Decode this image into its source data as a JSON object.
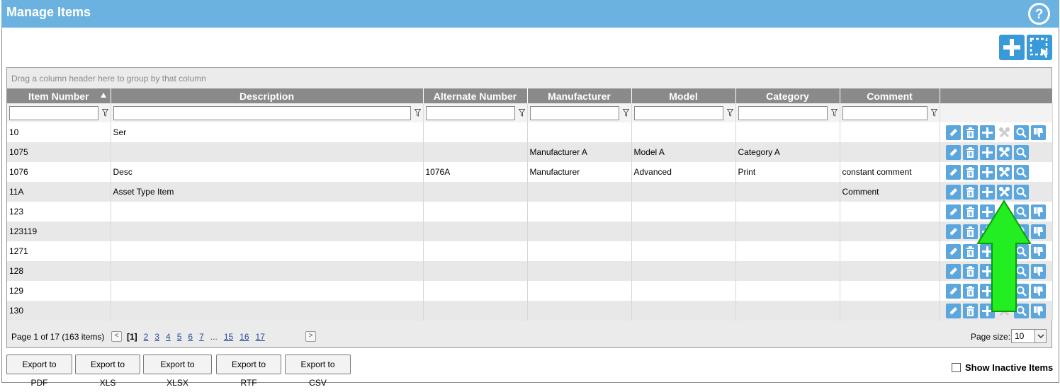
{
  "window": {
    "title": "Manage Items"
  },
  "icons": {
    "help": "help-icon",
    "add": "plus-icon",
    "select": "select-area-icon",
    "filter": "filter-icon",
    "edit": "pencil-icon",
    "delete": "trash-icon",
    "add_child": "plus-icon",
    "maintenance": "wrench-screwdriver-icon",
    "view": "magnifier-icon",
    "deactivate": "thumbs-down-icon"
  },
  "colors": {
    "header_bar": "#6cb2e0",
    "accent": "#3a9ad9",
    "action_icon": "#5aa6dd",
    "grid_header": "#8a8a8a",
    "annotation_arrow": "#22ee22"
  },
  "grid": {
    "group_hint": "Drag a column header here to group by that column",
    "columns": [
      "Item Number",
      "Description",
      "Alternate Number",
      "Manufacturer",
      "Model",
      "Category",
      "Comment"
    ],
    "sorted_column": "Item Number",
    "rows": [
      {
        "item_number": "10",
        "description": "Ser",
        "alternate_number": "",
        "manufacturer": "",
        "model": "",
        "category": "",
        "comment": "",
        "actions": [
          "edit",
          "delete",
          "add_child",
          "maintenance_disabled",
          "view",
          "deactivate"
        ]
      },
      {
        "item_number": "1075",
        "description": "",
        "alternate_number": "",
        "manufacturer": "Manufacturer A",
        "model": "Model A",
        "category": "Category A",
        "comment": "",
        "actions": [
          "edit",
          "delete",
          "add_child",
          "maintenance",
          "view"
        ]
      },
      {
        "item_number": "1076",
        "description": "Desc",
        "alternate_number": "1076A",
        "manufacturer": "Manufacturer",
        "model": "Advanced",
        "category": "Print",
        "comment": "constant comment",
        "actions": [
          "edit",
          "delete",
          "add_child",
          "maintenance",
          "view"
        ]
      },
      {
        "item_number": "11A",
        "description": "Asset Type Item",
        "alternate_number": "",
        "manufacturer": "",
        "model": "",
        "category": "",
        "comment": "Comment",
        "actions": [
          "edit",
          "delete",
          "add_child",
          "maintenance",
          "view"
        ]
      },
      {
        "item_number": "123",
        "description": "",
        "alternate_number": "",
        "manufacturer": "",
        "model": "",
        "category": "",
        "comment": "",
        "actions": [
          "edit",
          "delete",
          "add_child",
          "maintenance_disabled",
          "view",
          "deactivate"
        ]
      },
      {
        "item_number": "123119",
        "description": "",
        "alternate_number": "",
        "manufacturer": "",
        "model": "",
        "category": "",
        "comment": "",
        "actions": [
          "edit",
          "delete",
          "add_child",
          "maintenance_disabled",
          "view",
          "deactivate"
        ]
      },
      {
        "item_number": "1271",
        "description": "",
        "alternate_number": "",
        "manufacturer": "",
        "model": "",
        "category": "",
        "comment": "",
        "actions": [
          "edit",
          "delete",
          "add_child",
          "maintenance_disabled",
          "view",
          "deactivate"
        ]
      },
      {
        "item_number": "128",
        "description": "",
        "alternate_number": "",
        "manufacturer": "",
        "model": "",
        "category": "",
        "comment": "",
        "actions": [
          "edit",
          "delete",
          "add_child",
          "maintenance_disabled",
          "view",
          "deactivate"
        ]
      },
      {
        "item_number": "129",
        "description": "",
        "alternate_number": "",
        "manufacturer": "",
        "model": "",
        "category": "",
        "comment": "",
        "actions": [
          "edit",
          "delete",
          "add_child",
          "maintenance_disabled",
          "view",
          "deactivate"
        ]
      },
      {
        "item_number": "130",
        "description": "",
        "alternate_number": "",
        "manufacturer": "",
        "model": "",
        "category": "",
        "comment": "",
        "actions": [
          "edit",
          "delete",
          "add_child",
          "maintenance_disabled",
          "view",
          "deactivate"
        ]
      }
    ]
  },
  "pager": {
    "info": "Page 1 of 17 (163 items)",
    "prev": "<",
    "next": ">",
    "pages": [
      "[1]",
      "2",
      "3",
      "4",
      "5",
      "6",
      "7",
      "...",
      "15",
      "16",
      "17"
    ],
    "page_size_label": "Page size:",
    "page_size_value": "10"
  },
  "export_buttons": [
    "Export to PDF",
    "Export to XLS",
    "Export to XLSX",
    "Export to RTF",
    "Export to CSV"
  ],
  "show_inactive_label": "Show Inactive Items"
}
